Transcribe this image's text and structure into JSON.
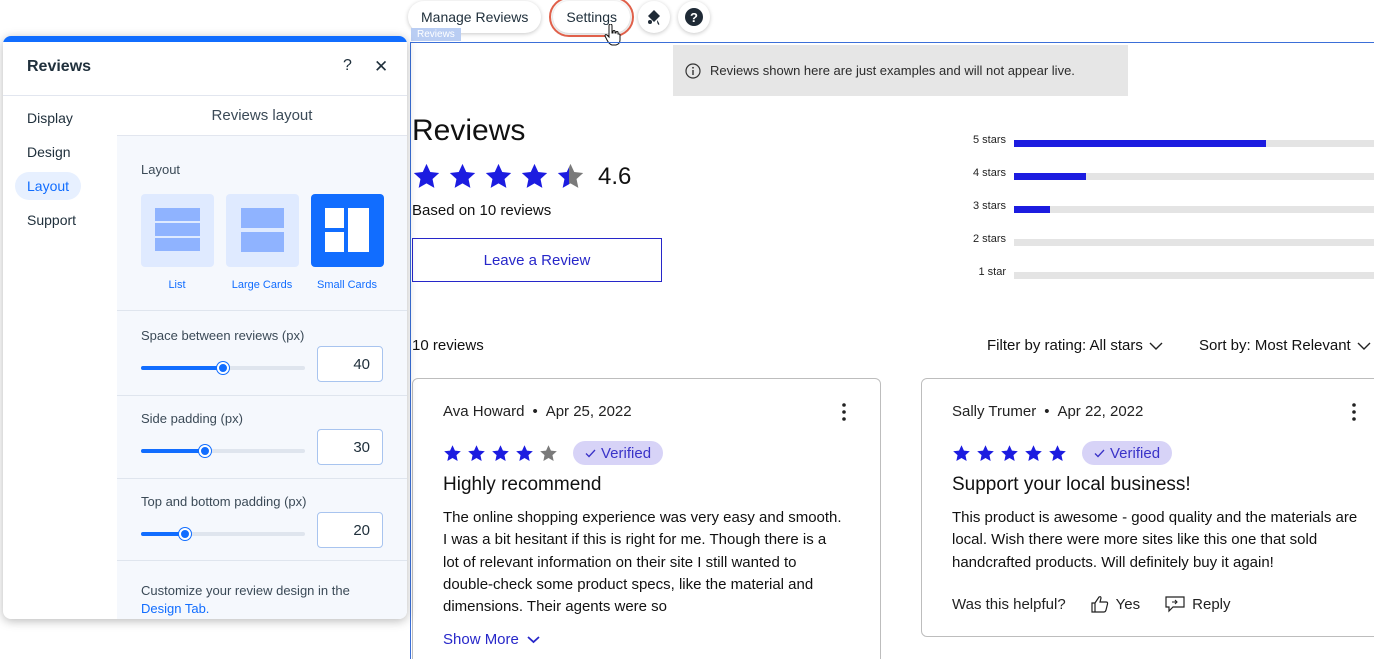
{
  "toolbar": {
    "manage_reviews": "Manage Reviews",
    "settings": "Settings",
    "design_icon": "paint-drop-icon",
    "help_icon": "help-circle-icon"
  },
  "frame_tag": "Reviews",
  "notice": {
    "text": "Reviews shown here are just examples and will not appear live."
  },
  "summary": {
    "title": "Reviews",
    "rating": 4.6,
    "rating_text": "4.6",
    "based_on": "Based on 10 reviews",
    "leave_review": "Leave a Review"
  },
  "distribution": [
    {
      "label": "5 stars",
      "fraction": 0.7
    },
    {
      "label": "4 stars",
      "fraction": 0.2
    },
    {
      "label": "3 stars",
      "fraction": 0.1
    },
    {
      "label": "2 stars",
      "fraction": 0
    },
    {
      "label": "1 star",
      "fraction": 0
    }
  ],
  "list_header": {
    "count": "10 reviews",
    "filter": "Filter by rating: All stars",
    "sort": "Sort by: Most Relevant"
  },
  "reviews": [
    {
      "author": "Ava Howard",
      "separator": "•",
      "date": "Apr 25, 2022",
      "stars": 4,
      "verified": "Verified",
      "title": "Highly recommend",
      "body": "The online shopping experience was very easy and smooth. I was a bit hesitant if this is right for me. Though there is a lot of relevant information on their site I still wanted to double-check some product specs, like the material and dimensions. Their agents were so",
      "show_more": "Show More"
    },
    {
      "author": "Sally Trumer",
      "separator": "•",
      "date": "Apr 22, 2022",
      "stars": 5,
      "verified": "Verified",
      "title": "Support your local business!",
      "body": "This product is awesome - good quality and the materials are local. Wish there were more sites like this one that sold handcrafted products. Will definitely buy it again!",
      "helpful": "Was this helpful?",
      "yes": "Yes",
      "reply": "Reply"
    }
  ],
  "panel": {
    "title": "Reviews",
    "help": "?",
    "close": "✕",
    "nav": [
      "Display",
      "Design",
      "Layout",
      "Support"
    ],
    "active_nav": "Layout",
    "section_title": "Reviews layout",
    "layout_label": "Layout",
    "layouts": [
      "List",
      "Large Cards",
      "Small Cards"
    ],
    "selected_layout": "Small Cards",
    "space_label": "Space between reviews (px)",
    "space_value": "40",
    "space_fraction": 0.5,
    "side_label": "Side padding (px)",
    "side_value": "30",
    "side_fraction": 0.39,
    "tb_label": "Top and bottom padding (px)",
    "tb_value": "20",
    "tb_fraction": 0.27,
    "footer_text": "Customize your review design in the ",
    "footer_link": "Design Tab."
  },
  "colors": {
    "accent": "#116dff",
    "star": "#1c1ce0",
    "star_empty": "#7a7a7a",
    "link": "#2727c9",
    "highlight": "#e0604a"
  }
}
